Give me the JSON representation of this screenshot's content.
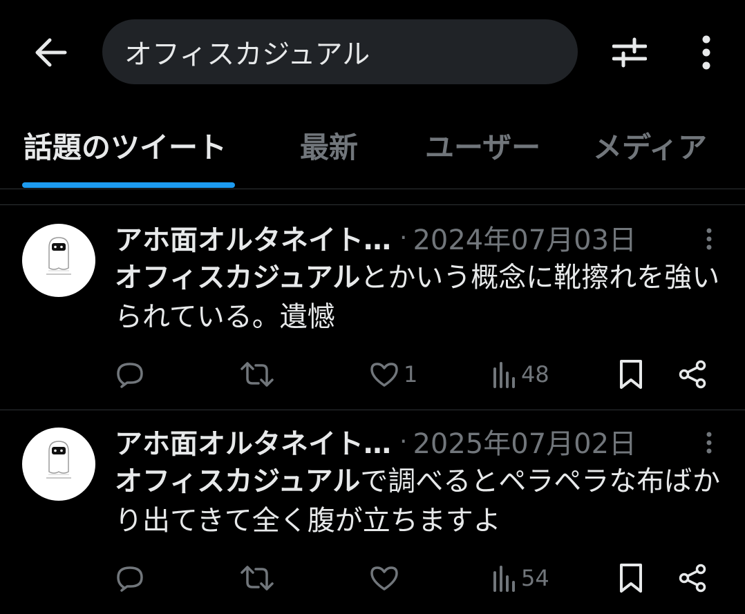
{
  "search": {
    "query": "オフィスカジュアル"
  },
  "tabs": [
    {
      "label": "話題のツイート"
    },
    {
      "label": "最新"
    },
    {
      "label": "ユーザー"
    },
    {
      "label": "メディア"
    }
  ],
  "tweets": [
    {
      "author": "アホ面オルタネイト…",
      "separator": "·",
      "date": "2024年07月03日",
      "highlight": "オフィスカジュアル",
      "text": "とかいう概念に靴擦れを強いられている。遺憾",
      "stats": {
        "replies": "",
        "retweets": "",
        "likes": "1",
        "views": "48"
      }
    },
    {
      "author": "アホ面オルタネイト…",
      "separator": "·",
      "date": "2025年07月02日",
      "highlight": "オフィスカジュアル",
      "text": "で調べるとペラペラな布ばかり出てきて全く腹が立ちますよ",
      "stats": {
        "replies": "",
        "retweets": "",
        "likes": "",
        "views": "54"
      }
    }
  ],
  "icons": {
    "back": "arrow-left-icon",
    "filter": "sliders-icon",
    "more": "more-vertical-icon",
    "reply": "comment-icon",
    "retweet": "retweet-icon",
    "like": "heart-icon",
    "views": "bar-chart-icon",
    "bookmark": "bookmark-icon",
    "share": "share-icon"
  },
  "colors": {
    "background": "#000000",
    "text": "#e7e9ea",
    "muted": "#71767b",
    "accent": "#1d9bf0",
    "search_bg": "#202327"
  }
}
